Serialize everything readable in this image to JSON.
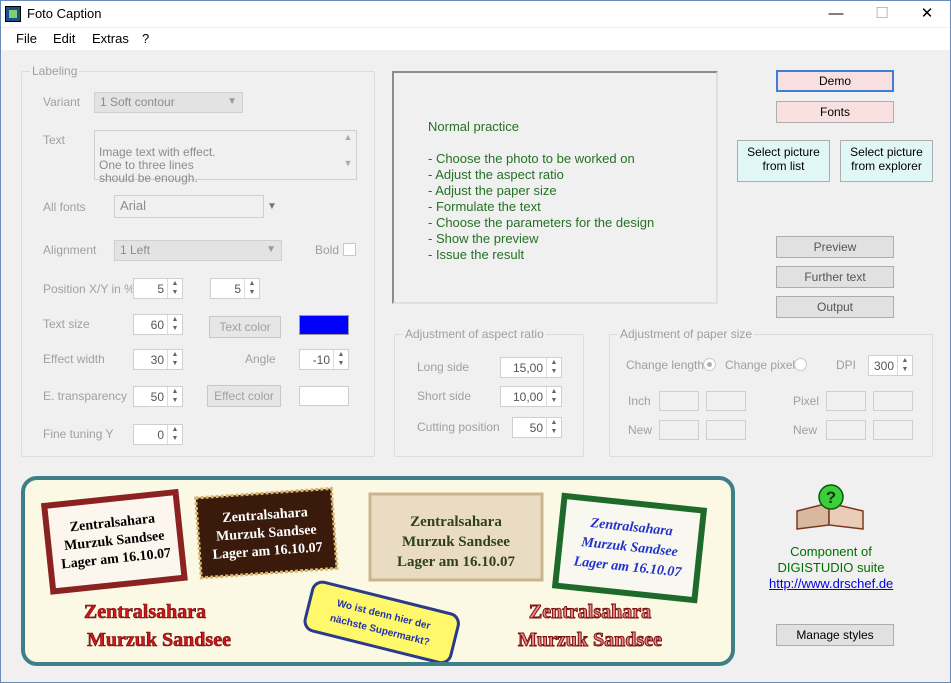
{
  "window": {
    "title": "Foto Caption",
    "minimize": "—",
    "maximize": "☐",
    "close": "✕"
  },
  "menu": [
    "File",
    "Edit",
    "Extras",
    "?"
  ],
  "labeling": {
    "title": "Labeling",
    "variant_label": "Variant",
    "variant_value": "1 Soft contour",
    "text_label": "Text",
    "text_value": "Image text with effect.\nOne to three lines\nshould be enough.",
    "all_fonts_label": "All fonts",
    "font_value": "Arial",
    "alignment_label": "Alignment",
    "alignment_value": "1 Left",
    "bold_label": "Bold",
    "position_label": "Position X/Y in %",
    "pos_x": "5",
    "pos_y": "5",
    "text_size_label": "Text size",
    "text_size": "60",
    "text_color_button": "Text color",
    "text_color": "#0000ff",
    "effect_width_label": "Effect width",
    "effect_width": "30",
    "angle_label": "Angle",
    "angle": "-10",
    "transparency_label": "E. transparency",
    "transparency": "50",
    "effect_color_button": "Effect color",
    "effect_color": "#ffffff",
    "fine_tuning_label": "Fine tuning Y",
    "fine_tuning": "0"
  },
  "info": {
    "heading": "Normal practice",
    "steps": [
      "- Choose the photo to be worked on",
      "- Adjust the aspect ratio",
      "- Adjust the paper size",
      "- Formulate the text",
      "- Choose the parameters for the design",
      "- Show the preview",
      "- Issue the result"
    ]
  },
  "buttons": {
    "demo": "Demo",
    "fonts": "Fonts",
    "select_list_1": "Select picture",
    "select_list_2": "from list",
    "select_explorer_1": "Select picture",
    "select_explorer_2": "from explorer",
    "preview": "Preview",
    "further_text": "Further text",
    "output": "Output",
    "manage_styles": "Manage styles"
  },
  "aspect": {
    "title": "Adjustment of aspect ratio",
    "long_label": "Long side",
    "long_value": "15,00",
    "short_label": "Short side",
    "short_value": "10,00",
    "cut_label": "Cutting position",
    "cut_value": "50"
  },
  "paper": {
    "title": "Adjustment of paper size",
    "change_length": "Change length",
    "change_pixel": "Change pixel",
    "dpi_label": "DPI",
    "dpi_value": "300",
    "inch_label": "Inch",
    "pixel_label": "Pixel",
    "new_label": "New",
    "new_label_2": "New"
  },
  "banner": {
    "label1": [
      "Zentralsahara",
      "Murzuk Sandsee",
      "Lager am 16.10.07"
    ],
    "label2": [
      "Zentralsahara",
      "Murzuk Sandsee",
      "Lager am 16.10.07"
    ],
    "label3": [
      "Zentralsahara",
      "Murzuk Sandsee",
      "Lager am 16.10.07"
    ],
    "label4": [
      "Zentralsahara",
      "Murzuk Sandsee",
      "Lager am 16.10.07"
    ],
    "red1": [
      "Zentralsahara",
      "Murzuk Sandsee"
    ],
    "yellow": [
      "Wo ist denn hier der",
      "nächste Supermarkt?"
    ],
    "red2": [
      "Zentralsahara",
      "Murzuk Sandsee"
    ]
  },
  "component": {
    "line1": "Component of",
    "line2": "DIGISTUDIO suite",
    "url": "http://www.drschef.de"
  }
}
